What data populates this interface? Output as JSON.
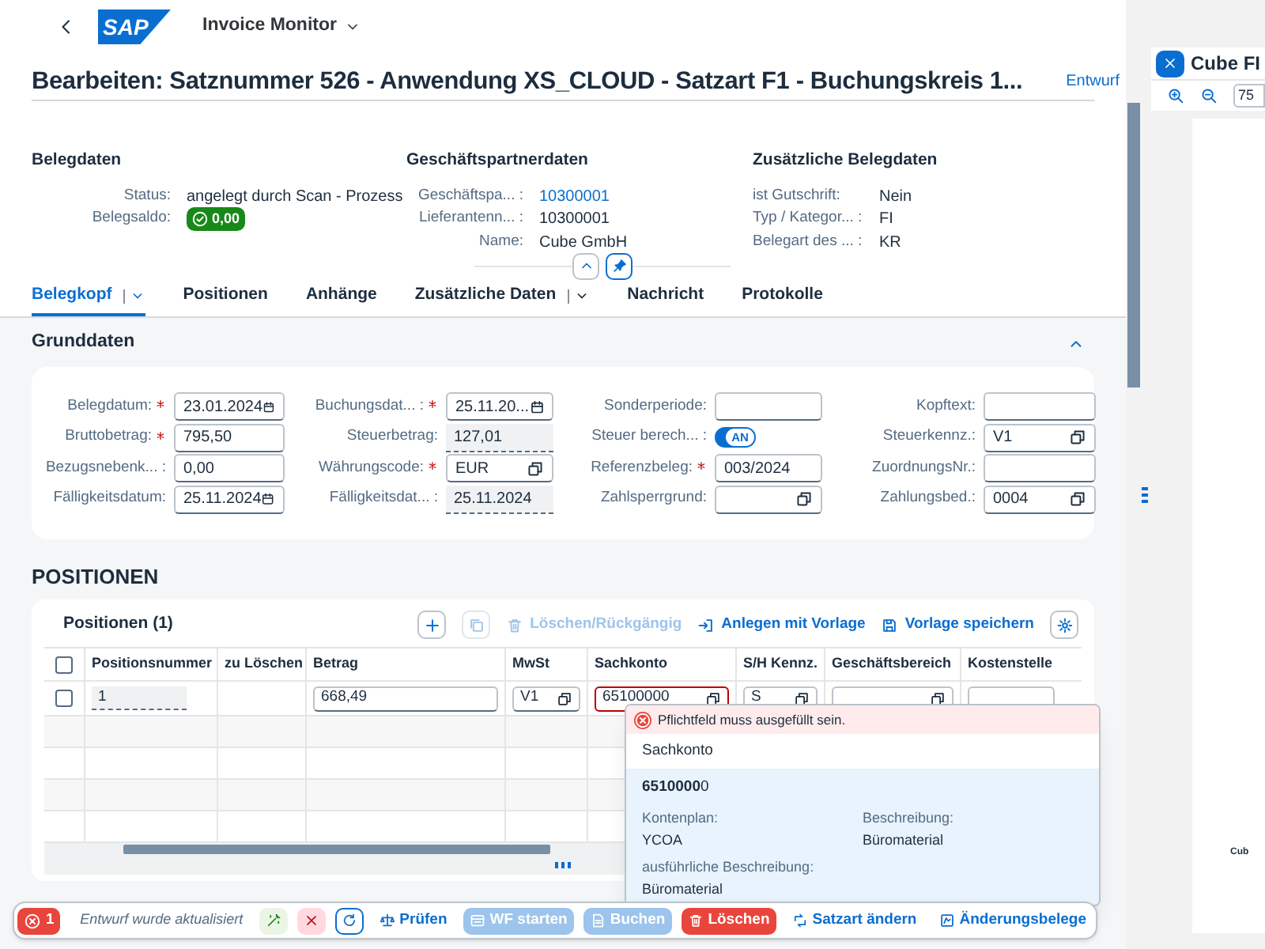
{
  "shell": {
    "logo": "SAP",
    "app_title": "Invoice Monitor"
  },
  "header": {
    "title": "Bearbeiten: Satznummer 526 - Anwendung XS_CLOUD - Satzart F1 - Buchungskreis 1...",
    "status": "Entwurf"
  },
  "header_groups": [
    {
      "title": "Belegdaten",
      "fields": [
        {
          "label": "Status:",
          "value": "angelegt durch Scan - Prozess",
          "kind": "text"
        },
        {
          "label": "Belegsaldo:",
          "value": "0,00",
          "kind": "badge"
        }
      ]
    },
    {
      "title": "Geschäftspartnerdaten",
      "fields": [
        {
          "label": "Geschäftspa... :",
          "value": "10300001",
          "kind": "link"
        },
        {
          "label": "Lieferantenn... :",
          "value": "10300001",
          "kind": "text"
        },
        {
          "label": "Name:",
          "value": "Cube GmbH",
          "kind": "text"
        }
      ]
    },
    {
      "title": "Zusätzliche Belegdaten",
      "fields": [
        {
          "label": "ist Gutschrift:",
          "value": "Nein",
          "kind": "text"
        },
        {
          "label": "Typ / Kategor... :",
          "value": "FI",
          "kind": "text"
        },
        {
          "label": "Belegart des ... :",
          "value": "KR",
          "kind": "text"
        }
      ]
    }
  ],
  "tabs": [
    {
      "label": "Belegkopf",
      "selected": true,
      "has_menu": true
    },
    {
      "label": "Positionen",
      "selected": false,
      "has_menu": false
    },
    {
      "label": "Anhänge",
      "selected": false,
      "has_menu": false
    },
    {
      "label": "Zusätzliche Daten",
      "selected": false,
      "has_menu": true
    },
    {
      "label": "Nachricht",
      "selected": false,
      "has_menu": false
    },
    {
      "label": "Protokolle",
      "selected": false,
      "has_menu": false
    }
  ],
  "section": {
    "title": "Grunddaten",
    "expanded": true
  },
  "form_columns": [
    [
      {
        "label": "Belegdatum:",
        "required": true,
        "value": "23.01.2024",
        "kind": "date"
      },
      {
        "label": "Bruttobetrag:",
        "required": true,
        "value": "795,50",
        "kind": "input"
      },
      {
        "label": "Bezugsnebenk... :",
        "required": false,
        "value": "0,00",
        "kind": "input"
      },
      {
        "label": "Fälligkeitsdatum:",
        "required": false,
        "value": "25.11.2024",
        "kind": "date"
      }
    ],
    [
      {
        "label": "Buchungsdat... :",
        "required": true,
        "value": "25.11.20...",
        "kind": "date"
      },
      {
        "label": "Steuerbetrag:",
        "required": false,
        "value": "127,01",
        "kind": "readonly"
      },
      {
        "label": "Währungscode:",
        "required": true,
        "value": "EUR",
        "kind": "valuehelp"
      },
      {
        "label": "Fälligkeitsdat... :",
        "required": false,
        "value": "25.11.2024",
        "kind": "readonly"
      }
    ],
    [
      {
        "label": "Sonderperiode:",
        "required": false,
        "kind": "input"
      },
      {
        "label": "Steuer berech... :",
        "required": false,
        "kind": "switch",
        "on": true,
        "value": "AN"
      },
      {
        "label": "Referenzbeleg:",
        "required": true,
        "value": "003/2024",
        "kind": "input"
      },
      {
        "label": "Zahlsperrgrund:",
        "required": false,
        "kind": "valuehelp"
      }
    ],
    [
      {
        "label": "Kopftext:",
        "required": false,
        "kind": "input"
      },
      {
        "label": "Steuerkennz.:",
        "required": false,
        "value": "V1",
        "kind": "valuehelp"
      },
      {
        "label": "ZuordnungsNr.:",
        "required": false,
        "kind": "input"
      },
      {
        "label": "Zahlungsbed.:",
        "required": false,
        "value": "0004",
        "kind": "valuehelp"
      }
    ]
  ],
  "positions": {
    "heading": "POSITIONEN",
    "table_title": "Positionen (1)",
    "toolbar": [
      {
        "kind": "add",
        "disabled": false
      },
      {
        "kind": "copy",
        "disabled": true
      },
      {
        "kind": "delete",
        "label": "Löschen/Rückgängig",
        "disabled": true
      },
      {
        "kind": "template",
        "label": "Anlegen mit Vorlage",
        "disabled": false
      },
      {
        "kind": "save",
        "label": "Vorlage speichern",
        "disabled": false
      },
      {
        "kind": "settings",
        "disabled": false
      }
    ],
    "select_all": {
      "checked": false
    },
    "columns": [
      "Positionsnummer",
      "zu Löschen",
      "Betrag",
      "MwSt",
      "Sachkonto",
      "S/H Kennz.",
      "Geschäftsbereich",
      "Kostenstelle"
    ],
    "rows": [
      {
        "checked": false,
        "cells": [
          {
            "kind": "readonly",
            "value": "1"
          },
          {
            "kind": "empty"
          },
          {
            "kind": "input",
            "value": "668,49"
          },
          {
            "kind": "valuehelp",
            "value": "V1"
          },
          {
            "kind": "valuehelp",
            "value": "65100000",
            "error": true
          },
          {
            "kind": "valuehelp",
            "value": "S"
          },
          {
            "kind": "valuehelp"
          },
          {
            "kind": "input"
          }
        ]
      }
    ]
  },
  "popover": {
    "message": "Pflichtfeld muss ausgefüllt sein.",
    "header": "Sachkonto",
    "item": {
      "title": "**6510000**0",
      "fields": [
        {
          "label": "Kontenplan:",
          "value": "YCOA"
        },
        {
          "label": "Beschreibung:",
          "value": "Büromaterial"
        },
        {
          "label": "ausführliche Beschreibung:",
          "value": "Büromaterial"
        }
      ]
    }
  },
  "footer": {
    "errors": "1",
    "message": "Entwurf wurde aktualisiert",
    "buttons": [
      {
        "kind": "accept",
        "disabled": false
      },
      {
        "kind": "reject",
        "disabled": false
      },
      {
        "kind": "refresh",
        "disabled": false
      },
      {
        "kind": "check",
        "label": "Prüfen",
        "disabled": false
      },
      {
        "kind": "workflow",
        "label": "WF starten",
        "disabled": true
      },
      {
        "kind": "post",
        "label": "Buchen",
        "disabled": true
      },
      {
        "kind": "delete",
        "label": "Löschen",
        "disabled": false
      },
      {
        "kind": "change-type",
        "label": "Satzart ändern",
        "disabled": false
      },
      {
        "kind": "change-log",
        "label": "Änderungsbelege",
        "disabled": false
      }
    ]
  },
  "side_panel": {
    "title": "Cube FI",
    "zoom_value": "75",
    "page_text": "Cub"
  }
}
